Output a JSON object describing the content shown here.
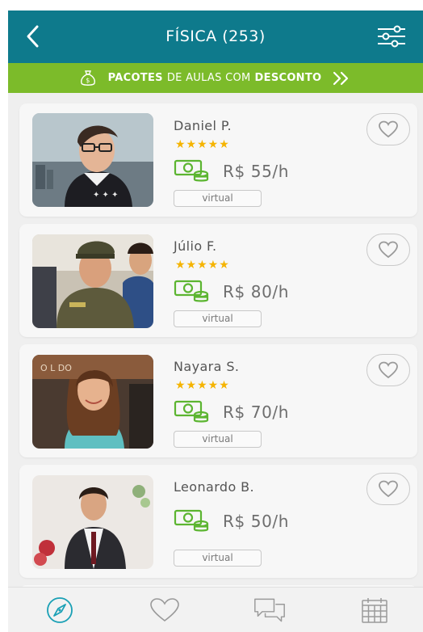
{
  "header": {
    "title": "FÍSICA (253)",
    "back_icon": "chevron-left-icon",
    "filter_icon": "sliders-icon"
  },
  "promo": {
    "part1": "PACOTES",
    "part2": "DE AULAS COM",
    "part3": "DESCONTO",
    "icon": "money-bag-icon"
  },
  "colors": {
    "header_bg": "#0e7a8c",
    "promo_bg": "#7cbb2a",
    "money_icon": "#5cb531",
    "star": "#f5b400"
  },
  "teachers": [
    {
      "name": "Daniel P.",
      "rating": 5,
      "stars": "★★★★★",
      "price": "R$ 55/h",
      "mode": "virtual"
    },
    {
      "name": "Júlio F.",
      "rating": 5,
      "stars": "★★★★★",
      "price": "R$ 80/h",
      "mode": "virtual"
    },
    {
      "name": "Nayara S.",
      "rating": 5,
      "stars": "★★★★★",
      "price": "R$ 70/h",
      "mode": "virtual"
    },
    {
      "name": "Leonardo B.",
      "rating": 0,
      "stars": "",
      "price": "R$ 50/h",
      "mode": "virtual"
    }
  ],
  "tabbar": {
    "items": [
      "compass-icon",
      "heart-icon",
      "chat-icon",
      "calendar-icon"
    ],
    "active": "compass-icon"
  }
}
